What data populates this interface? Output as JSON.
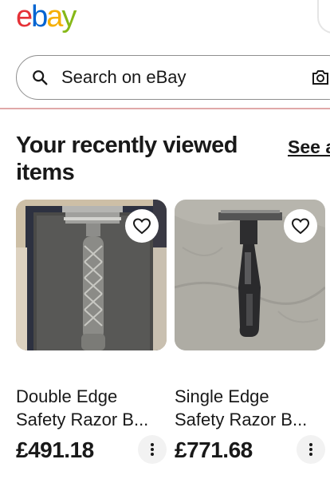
{
  "header": {
    "logo_letters": [
      "e",
      "b",
      "a",
      "y"
    ]
  },
  "search": {
    "placeholder": "Search on eBay",
    "icon": "search-icon",
    "camera_icon": "camera-icon"
  },
  "section": {
    "title_line1": "Your recently viewed",
    "title_line2": "items",
    "see_all": "See a"
  },
  "items": [
    {
      "title_line1": "Double Edge",
      "title_line2": "Safety Razor B...",
      "price": "£491.18"
    },
    {
      "title_line1": "Single Edge",
      "title_line2": "Safety Razor B...",
      "price": "£771.68"
    }
  ],
  "colors": {
    "logo_e": "#e53238",
    "logo_b": "#0064d2",
    "logo_a": "#f5af02",
    "logo_y": "#86b817",
    "divider": "#e0a8a8"
  }
}
